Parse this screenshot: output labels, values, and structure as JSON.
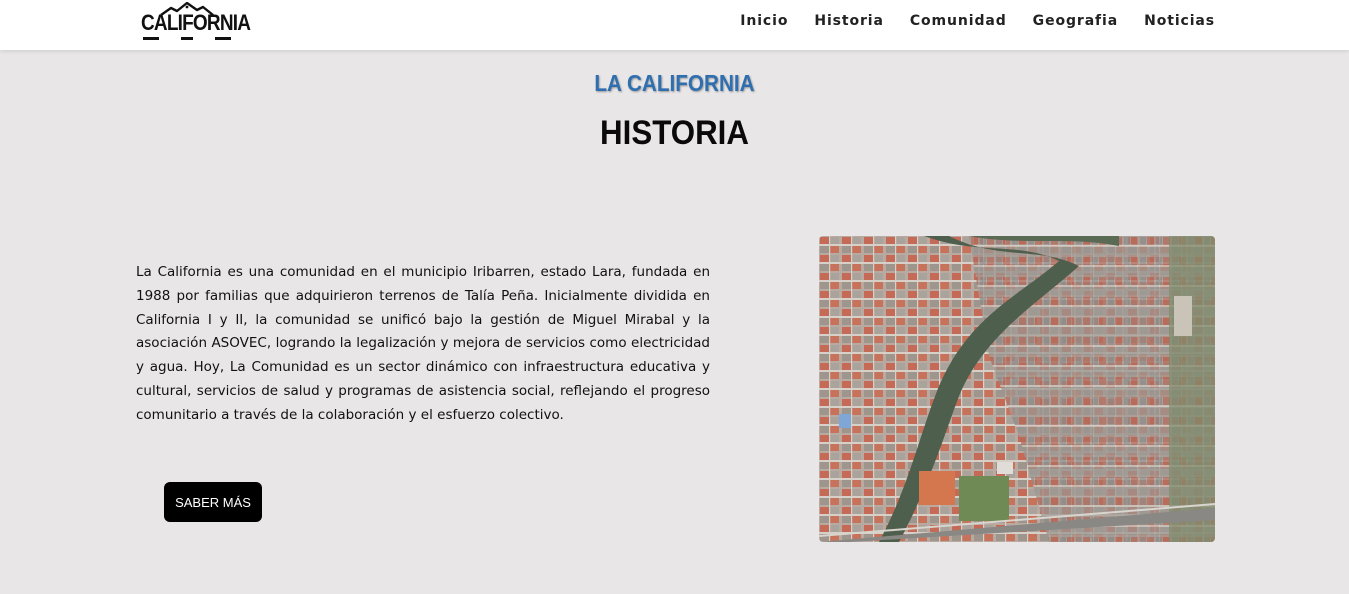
{
  "header": {
    "logo_text": "CALIFORNIA",
    "nav": [
      "Inicio",
      "Historia",
      "Comunidad",
      "Geografia",
      "Noticias"
    ]
  },
  "hero": {
    "eyebrow": "LA CALIFORNIA",
    "title": "HISTORIA"
  },
  "content": {
    "paragraph": "La California es una comunidad en el municipio Iribarren, estado Lara, fundada en 1988 por familias que adquirieron terrenos de Talía Peña. Inicialmente dividida en California I y II, la comunidad se unificó bajo la gestión de Miguel Mirabal y la asociación ASOVEC, logrando la legalización y mejora de servicios como electricidad y agua. Hoy, La Comunidad es un sector dinámico con infraestructura educativa y cultural, servicios de salud y programas de asistencia social, reflejando el progreso comunitario a través de la colaboración y el esfuerzo colectivo.",
    "button_label": "SABER MÁS"
  },
  "colors": {
    "accent": "#2f6fb0",
    "background": "#e8e6e7",
    "button": "#000000"
  }
}
